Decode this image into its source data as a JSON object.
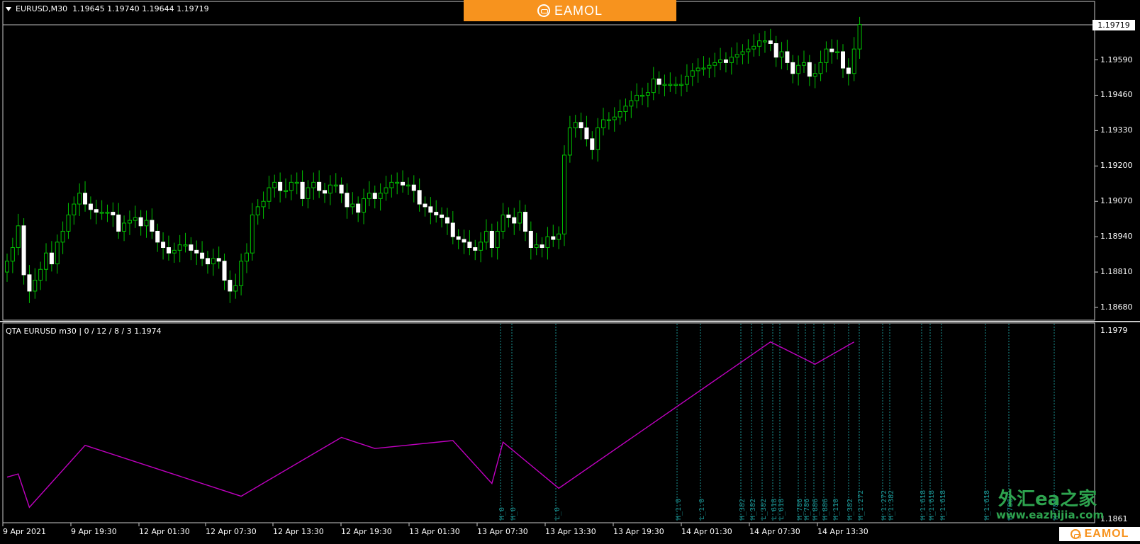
{
  "main_chart": {
    "header": {
      "symbol": "EURUSD,M30",
      "ohlc": "1.19645 1.19740 1.19644 1.19719"
    },
    "current_price_label": "1.19719",
    "price_labels": [
      "1.19590",
      "1.19460",
      "1.19330",
      "1.19200",
      "1.19070",
      "1.18940",
      "1.18810",
      "1.18680"
    ],
    "colors": {
      "bull": "#00c000",
      "bull_fill": "#ffffff",
      "bear": "#ffffff",
      "wick": "#00c000"
    }
  },
  "indicator": {
    "header": "QTA EURUSD m30 | 0 / 12 / 8 / 3 1.1974",
    "top_label": "1.1979",
    "bottom_label": "1.1861",
    "zigzag_color": "#c000c0",
    "level_line_color": "#1a8f8f",
    "level_labels": [
      "H_0",
      "H_0",
      "L_0",
      "H_1.0",
      "L_1.0",
      "H_382",
      "H_382",
      "L_382",
      "L_618",
      "L_618",
      "H_786",
      "H_786",
      "H_886",
      "H_886",
      "H_110",
      "H_382",
      "H_1.272",
      "H_1.272",
      "H_1.382",
      "H_1.618",
      "H_1.618",
      "H_1.618",
      "H_1.618",
      "H_786",
      "H_786"
    ]
  },
  "time_axis": [
    "9 Apr 2021",
    "9 Apr 19:30",
    "12 Apr 01:30",
    "12 Apr 07:30",
    "12 Apr 13:30",
    "12 Apr 19:30",
    "13 Apr 01:30",
    "13 Apr 07:30",
    "13 Apr 13:30",
    "13 Apr 19:30",
    "14 Apr 01:30",
    "14 Apr 07:30",
    "14 Apr 13:30"
  ],
  "branding": {
    "top_logo": "EAMOL",
    "bottom_logo": "EAMOL",
    "watermark_cn": "外汇ea之家",
    "watermark_url": "www.eazhijia.com"
  },
  "chart_data": {
    "type": "candlestick",
    "timeframe": "M30",
    "closes": [
      1.1885,
      1.189,
      1.1898,
      1.188,
      1.1874,
      1.1878,
      1.1882,
      1.1888,
      1.1884,
      1.1892,
      1.1896,
      1.1902,
      1.1906,
      1.191,
      1.1906,
      1.1904,
      1.1903,
      1.1903,
      1.1903,
      1.1902,
      1.1896,
      1.1899,
      1.19,
      1.1901,
      1.1898,
      1.19,
      1.1896,
      1.1892,
      1.189,
      1.1888,
      1.1889,
      1.1891,
      1.1891,
      1.1889,
      1.1888,
      1.1886,
      1.1884,
      1.1886,
      1.1885,
      1.1878,
      1.1874,
      1.1876,
      1.1885,
      1.1888,
      1.1902,
      1.1905,
      1.1907,
      1.1912,
      1.1914,
      1.1911,
      1.1911,
      1.1914,
      1.1914,
      1.1908,
      1.1912,
      1.1914,
      1.1911,
      1.191,
      1.1913,
      1.1913,
      1.191,
      1.1905,
      1.1906,
      1.1903,
      1.1908,
      1.191,
      1.1908,
      1.191,
      1.1912,
      1.1914,
      1.1914,
      1.1913,
      1.1913,
      1.1911,
      1.1906,
      1.1905,
      1.1903,
      1.1902,
      1.1901,
      1.1899,
      1.1894,
      1.1893,
      1.1892,
      1.189,
      1.1889,
      1.1892,
      1.1896,
      1.189,
      1.1896,
      1.1902,
      1.1901,
      1.1899,
      1.1903,
      1.1896,
      1.189,
      1.1891,
      1.189,
      1.1894,
      1.1893,
      1.1895,
      1.1924,
      1.1934,
      1.1936,
      1.1934,
      1.193,
      1.1926,
      1.1934,
      1.1937,
      1.1937,
      1.1938,
      1.194,
      1.1942,
      1.1944,
      1.1946,
      1.1946,
      1.1947,
      1.1952,
      1.195,
      1.195,
      1.195,
      1.195,
      1.195,
      1.1953,
      1.1955,
      1.1956,
      1.1956,
      1.1957,
      1.1958,
      1.1959,
      1.1958,
      1.196,
      1.1961,
      1.1962,
      1.1963,
      1.1964,
      1.1966,
      1.1966,
      1.1965,
      1.196,
      1.1962,
      1.1958,
      1.1954,
      1.1957,
      1.1958,
      1.1953,
      1.1954,
      1.1958,
      1.1963,
      1.1962,
      1.1962,
      1.1956,
      1.1954,
      1.1963,
      1.1972
    ]
  }
}
